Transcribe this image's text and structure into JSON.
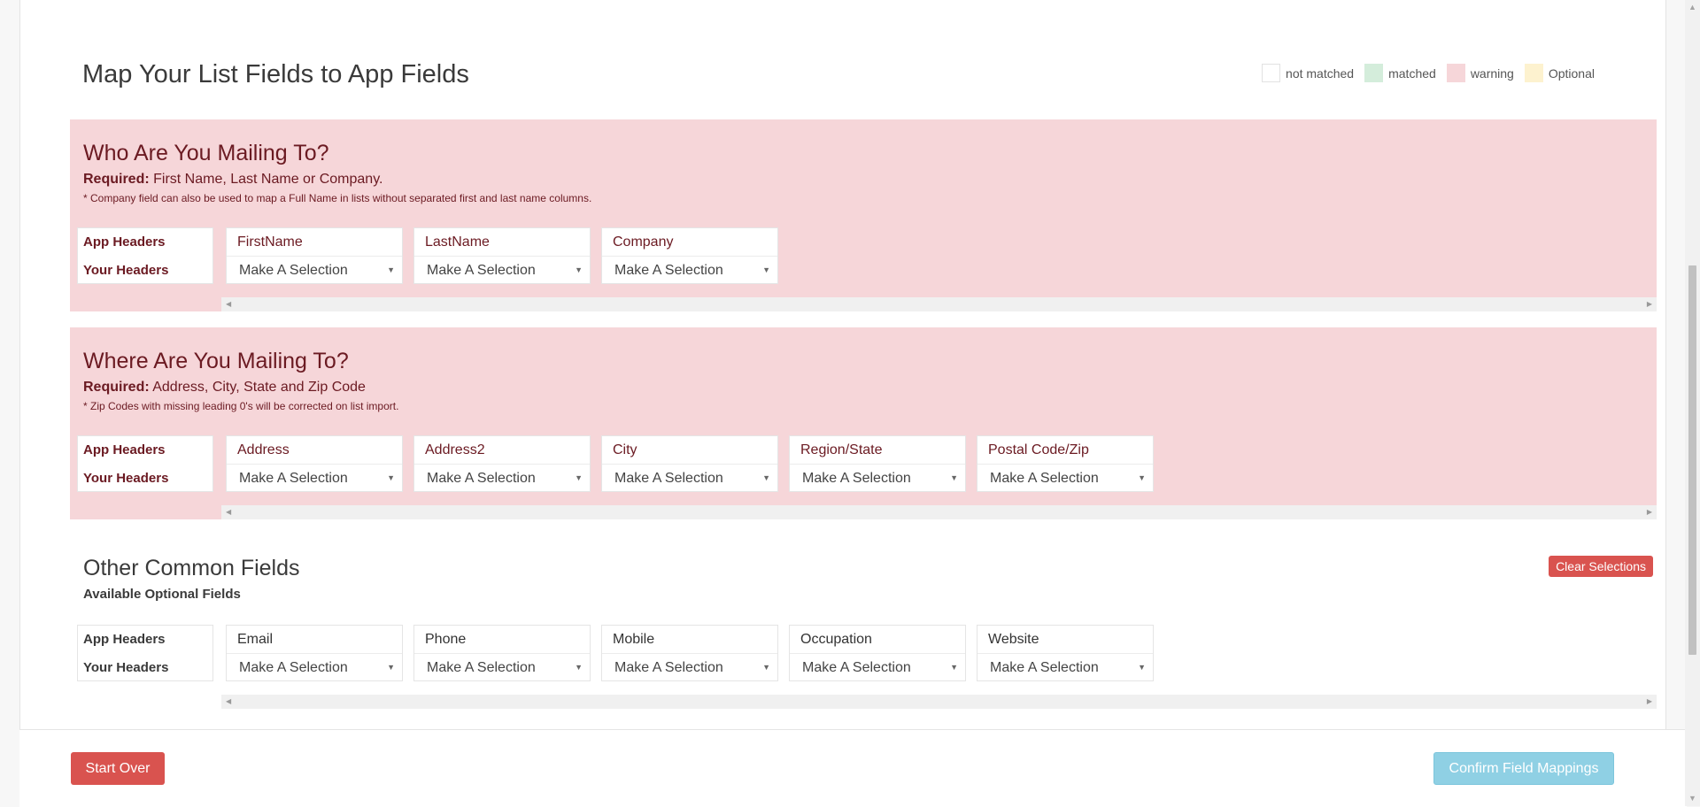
{
  "page_title": "Map Your List Fields to App Fields",
  "legend": [
    {
      "label": "not matched",
      "color": "#ffffff"
    },
    {
      "label": "matched",
      "color": "#d4eddb"
    },
    {
      "label": "warning",
      "color": "#f6d6d9"
    },
    {
      "label": "Optional",
      "color": "#fdf2cf"
    }
  ],
  "row_labels": {
    "app": "App Headers",
    "yours": "Your Headers"
  },
  "select_placeholder": "Make A Selection",
  "sections": [
    {
      "title": "Who Are You Mailing To?",
      "required_label": "Required:",
      "required_text": "First Name, Last Name or Company.",
      "note": "* Company field can also be used to map a Full Name in lists without separated first and last name columns.",
      "fields": [
        "FirstName",
        "LastName",
        "Company"
      ]
    },
    {
      "title": "Where Are You Mailing To?",
      "required_label": "Required:",
      "required_text": "Address, City, State and Zip Code",
      "note": "* Zip Codes with missing leading 0's will be corrected on list import.",
      "fields": [
        "Address",
        "Address2",
        "City",
        "Region/State",
        "Postal Code/Zip"
      ]
    },
    {
      "title": "Other Common Fields",
      "subtitle": "Available Optional Fields",
      "fields": [
        "Email",
        "Phone",
        "Mobile",
        "Occupation",
        "Website"
      ]
    }
  ],
  "clear_button": "Clear Selections",
  "footer": {
    "start_over": "Start Over",
    "confirm": "Confirm Field Mappings"
  }
}
